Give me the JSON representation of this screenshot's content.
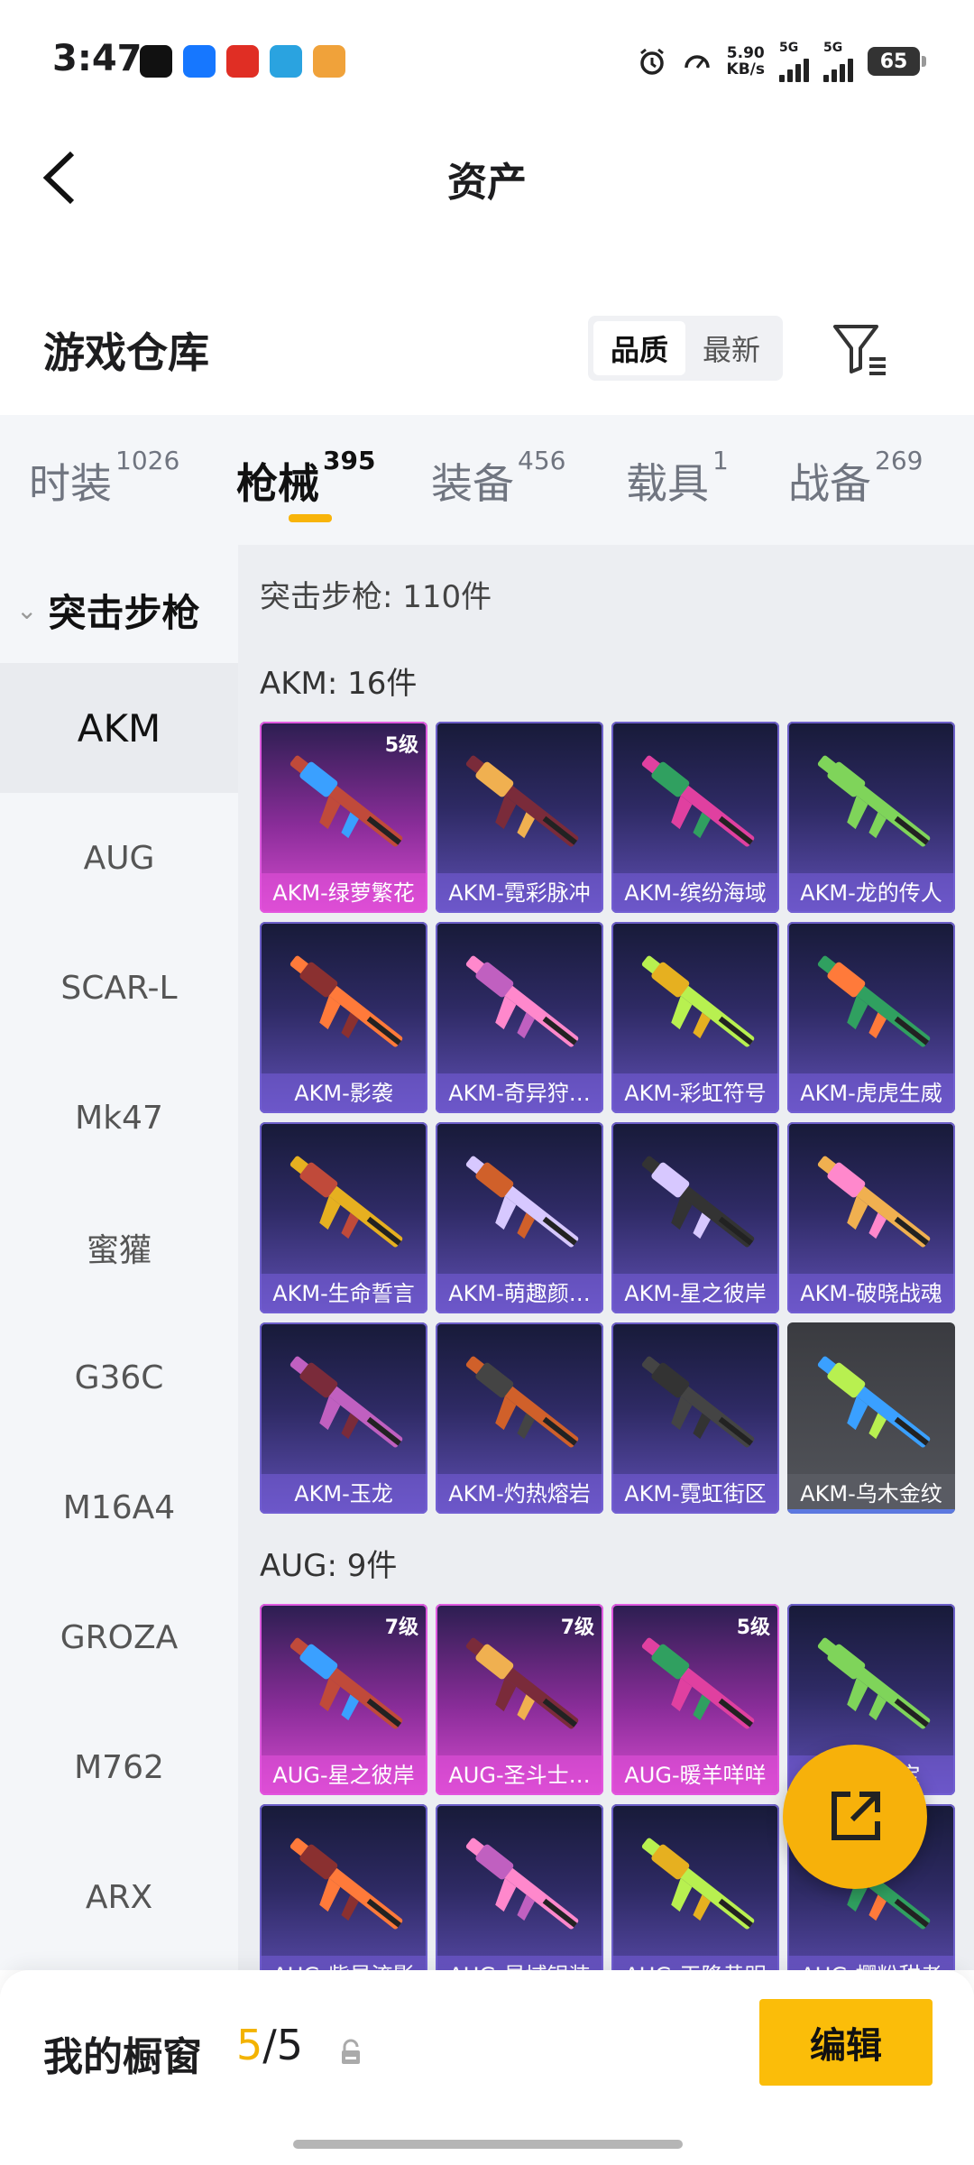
{
  "status_bar": {
    "time": "3:47",
    "network_speed": "5.90",
    "network_unit": "KB/s",
    "signal1": "5G",
    "signal2": "5G",
    "battery": "65",
    "app_icons": [
      "tiktok-icon",
      "alipay-icon",
      "pinduoduo-icon",
      "telegram-icon",
      "gov-app-icon"
    ],
    "status_icons": [
      "alarm-icon",
      "speed-icon"
    ]
  },
  "header": {
    "title": "资产",
    "back_icon": "back-arrow-icon"
  },
  "warehouse": {
    "title": "游戏仓库",
    "sort_options": [
      "品质",
      "最新"
    ],
    "sort_selected": "品质",
    "filter_icon": "filter-icon"
  },
  "tabs": [
    {
      "label": "时装",
      "count": "1026"
    },
    {
      "label": "枪械",
      "count": "395",
      "active": true
    },
    {
      "label": "装备",
      "count": "456"
    },
    {
      "label": "载具",
      "count": "1"
    },
    {
      "label": "战备",
      "count": "269"
    }
  ],
  "sidebar": {
    "category": "突击步枪",
    "items": [
      "AKM",
      "AUG",
      "SCAR-L",
      "Mk47",
      "蜜獾",
      "G36C",
      "M16A4",
      "GROZA",
      "M762",
      "ARX"
    ],
    "active": "AKM"
  },
  "content": {
    "category_summary": "突击步枪: 110件",
    "sections": [
      {
        "title": "AKM: 16件",
        "items": [
          {
            "name": "AKM-绿萝繁花",
            "level": "5级",
            "rarity": "pink"
          },
          {
            "name": "AKM-霓彩脉冲",
            "level": "",
            "rarity": "purple"
          },
          {
            "name": "AKM-缤纷海域",
            "level": "",
            "rarity": "purple"
          },
          {
            "name": "AKM-龙的传人",
            "level": "",
            "rarity": "purple"
          },
          {
            "name": "AKM-影袭",
            "level": "",
            "rarity": "purple"
          },
          {
            "name": "AKM-奇异狩…",
            "level": "",
            "rarity": "purple"
          },
          {
            "name": "AKM-彩虹符号",
            "level": "",
            "rarity": "purple"
          },
          {
            "name": "AKM-虎虎生威",
            "level": "",
            "rarity": "purple"
          },
          {
            "name": "AKM-生命誓言",
            "level": "",
            "rarity": "purple"
          },
          {
            "name": "AKM-萌趣颜…",
            "level": "",
            "rarity": "purple"
          },
          {
            "name": "AKM-星之彼岸",
            "level": "",
            "rarity": "purple"
          },
          {
            "name": "AKM-破晓战魂",
            "level": "",
            "rarity": "purple"
          },
          {
            "name": "AKM-玉龙",
            "level": "",
            "rarity": "purple"
          },
          {
            "name": "AKM-灼热熔岩",
            "level": "",
            "rarity": "purple"
          },
          {
            "name": "AKM-霓虹街区",
            "level": "",
            "rarity": "purple"
          },
          {
            "name": "AKM-乌木金纹",
            "level": "",
            "rarity": "gray"
          }
        ]
      },
      {
        "title": "AUG: 9件",
        "items": [
          {
            "name": "AUG-星之彼岸",
            "level": "7级",
            "rarity": "pink"
          },
          {
            "name": "AUG-圣斗士…",
            "level": "7级",
            "rarity": "pink"
          },
          {
            "name": "AUG-暖羊咩咩",
            "level": "5级",
            "rarity": "pink"
          },
          {
            "name": "AUG-雪宝",
            "level": "",
            "rarity": "purple"
          },
          {
            "name": "AUG-紫星流影",
            "level": "",
            "rarity": "purple"
          },
          {
            "name": "AUG-星域银装",
            "level": "",
            "rarity": "purple"
          },
          {
            "name": "AUG-天降黄明",
            "level": "",
            "rarity": "purple"
          },
          {
            "name": "AUG-樱粉甜者",
            "level": "",
            "rarity": "purple"
          }
        ]
      }
    ]
  },
  "showcase": {
    "label": "我的橱窗",
    "used": "5",
    "total": "5",
    "lock_icon": "lock-icon",
    "edit_label": "编辑"
  },
  "fab": {
    "icon": "share-export-icon"
  },
  "colors": {
    "accent": "#fbbd09",
    "rarity_pink": "#d64ccf",
    "rarity_purple": "#5f4fb4",
    "rarity_gray": "#54565c"
  }
}
